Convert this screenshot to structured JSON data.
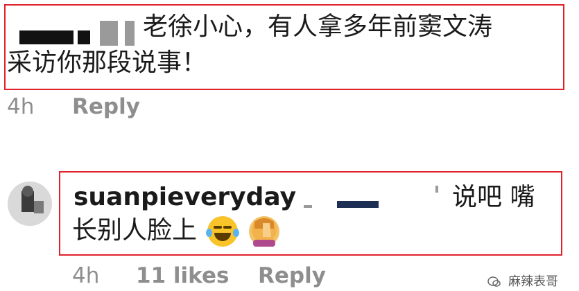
{
  "comments": [
    {
      "text_line1": "老徐小心，有人拿多年前窦文涛",
      "text_line2": "采访你那段说事！",
      "time": "4h",
      "reply": "Reply"
    },
    {
      "username": "suanpieveryday",
      "text_right": "说吧 嘴",
      "text_line2": "长别人脸上",
      "time": "4h",
      "likes": "11 likes",
      "reply": "Reply"
    }
  ],
  "watermark": "麻辣表哥",
  "icons": {
    "emoji_1": "face-with-tears-of-joy-icon",
    "emoji_2": "facepalm-icon",
    "watermark_icon": "wechat-icon"
  },
  "accent_color": "#e0212b"
}
